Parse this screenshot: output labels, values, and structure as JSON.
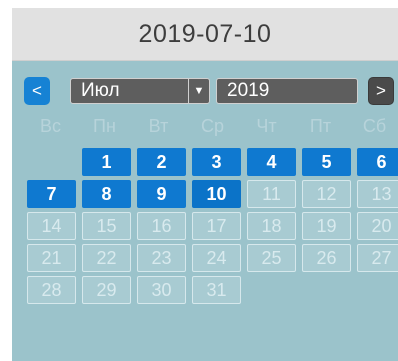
{
  "header": {
    "date": "2019-07-10"
  },
  "nav": {
    "prev_label": "<",
    "next_label": ">"
  },
  "month_select": {
    "value": "Июл",
    "arrow": "▼"
  },
  "year_input": {
    "value": "2019"
  },
  "weekdays": [
    "Вс",
    "Пн",
    "Вт",
    "Ср",
    "Чт",
    "Пт",
    "Сб"
  ],
  "weeks": [
    [
      null,
      "1",
      "2",
      "3",
      "4",
      "5",
      "6"
    ],
    [
      "7",
      "8",
      "9",
      "10",
      "11",
      "12",
      "13"
    ],
    [
      "14",
      "15",
      "16",
      "17",
      "18",
      "19",
      "20"
    ],
    [
      "21",
      "22",
      "23",
      "24",
      "25",
      "26",
      "27"
    ],
    [
      "28",
      "29",
      "30",
      "31",
      null,
      null,
      null
    ]
  ],
  "selected_day": "10",
  "last_enabled_day": 10,
  "colors": {
    "accent": "#1682d4",
    "panel": "#9bc3cb",
    "header_bg": "#e1e1e1",
    "select_bg": "#5e5e5e"
  }
}
